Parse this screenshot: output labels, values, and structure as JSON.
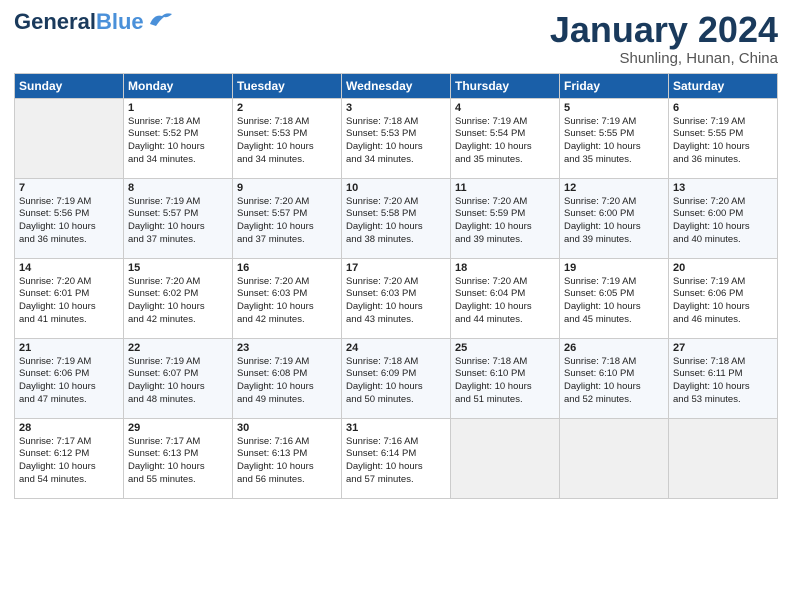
{
  "header": {
    "logo_line1": "General",
    "logo_line2": "Blue",
    "month": "January 2024",
    "location": "Shunling, Hunan, China"
  },
  "days_of_week": [
    "Sunday",
    "Monday",
    "Tuesday",
    "Wednesday",
    "Thursday",
    "Friday",
    "Saturday"
  ],
  "weeks": [
    [
      {
        "day": "",
        "info": ""
      },
      {
        "day": "1",
        "info": "Sunrise: 7:18 AM\nSunset: 5:52 PM\nDaylight: 10 hours\nand 34 minutes."
      },
      {
        "day": "2",
        "info": "Sunrise: 7:18 AM\nSunset: 5:53 PM\nDaylight: 10 hours\nand 34 minutes."
      },
      {
        "day": "3",
        "info": "Sunrise: 7:18 AM\nSunset: 5:53 PM\nDaylight: 10 hours\nand 34 minutes."
      },
      {
        "day": "4",
        "info": "Sunrise: 7:19 AM\nSunset: 5:54 PM\nDaylight: 10 hours\nand 35 minutes."
      },
      {
        "day": "5",
        "info": "Sunrise: 7:19 AM\nSunset: 5:55 PM\nDaylight: 10 hours\nand 35 minutes."
      },
      {
        "day": "6",
        "info": "Sunrise: 7:19 AM\nSunset: 5:55 PM\nDaylight: 10 hours\nand 36 minutes."
      }
    ],
    [
      {
        "day": "7",
        "info": "Sunrise: 7:19 AM\nSunset: 5:56 PM\nDaylight: 10 hours\nand 36 minutes."
      },
      {
        "day": "8",
        "info": "Sunrise: 7:19 AM\nSunset: 5:57 PM\nDaylight: 10 hours\nand 37 minutes."
      },
      {
        "day": "9",
        "info": "Sunrise: 7:20 AM\nSunset: 5:57 PM\nDaylight: 10 hours\nand 37 minutes."
      },
      {
        "day": "10",
        "info": "Sunrise: 7:20 AM\nSunset: 5:58 PM\nDaylight: 10 hours\nand 38 minutes."
      },
      {
        "day": "11",
        "info": "Sunrise: 7:20 AM\nSunset: 5:59 PM\nDaylight: 10 hours\nand 39 minutes."
      },
      {
        "day": "12",
        "info": "Sunrise: 7:20 AM\nSunset: 6:00 PM\nDaylight: 10 hours\nand 39 minutes."
      },
      {
        "day": "13",
        "info": "Sunrise: 7:20 AM\nSunset: 6:00 PM\nDaylight: 10 hours\nand 40 minutes."
      }
    ],
    [
      {
        "day": "14",
        "info": "Sunrise: 7:20 AM\nSunset: 6:01 PM\nDaylight: 10 hours\nand 41 minutes."
      },
      {
        "day": "15",
        "info": "Sunrise: 7:20 AM\nSunset: 6:02 PM\nDaylight: 10 hours\nand 42 minutes."
      },
      {
        "day": "16",
        "info": "Sunrise: 7:20 AM\nSunset: 6:03 PM\nDaylight: 10 hours\nand 42 minutes."
      },
      {
        "day": "17",
        "info": "Sunrise: 7:20 AM\nSunset: 6:03 PM\nDaylight: 10 hours\nand 43 minutes."
      },
      {
        "day": "18",
        "info": "Sunrise: 7:20 AM\nSunset: 6:04 PM\nDaylight: 10 hours\nand 44 minutes."
      },
      {
        "day": "19",
        "info": "Sunrise: 7:19 AM\nSunset: 6:05 PM\nDaylight: 10 hours\nand 45 minutes."
      },
      {
        "day": "20",
        "info": "Sunrise: 7:19 AM\nSunset: 6:06 PM\nDaylight: 10 hours\nand 46 minutes."
      }
    ],
    [
      {
        "day": "21",
        "info": "Sunrise: 7:19 AM\nSunset: 6:06 PM\nDaylight: 10 hours\nand 47 minutes."
      },
      {
        "day": "22",
        "info": "Sunrise: 7:19 AM\nSunset: 6:07 PM\nDaylight: 10 hours\nand 48 minutes."
      },
      {
        "day": "23",
        "info": "Sunrise: 7:19 AM\nSunset: 6:08 PM\nDaylight: 10 hours\nand 49 minutes."
      },
      {
        "day": "24",
        "info": "Sunrise: 7:18 AM\nSunset: 6:09 PM\nDaylight: 10 hours\nand 50 minutes."
      },
      {
        "day": "25",
        "info": "Sunrise: 7:18 AM\nSunset: 6:10 PM\nDaylight: 10 hours\nand 51 minutes."
      },
      {
        "day": "26",
        "info": "Sunrise: 7:18 AM\nSunset: 6:10 PM\nDaylight: 10 hours\nand 52 minutes."
      },
      {
        "day": "27",
        "info": "Sunrise: 7:18 AM\nSunset: 6:11 PM\nDaylight: 10 hours\nand 53 minutes."
      }
    ],
    [
      {
        "day": "28",
        "info": "Sunrise: 7:17 AM\nSunset: 6:12 PM\nDaylight: 10 hours\nand 54 minutes."
      },
      {
        "day": "29",
        "info": "Sunrise: 7:17 AM\nSunset: 6:13 PM\nDaylight: 10 hours\nand 55 minutes."
      },
      {
        "day": "30",
        "info": "Sunrise: 7:16 AM\nSunset: 6:13 PM\nDaylight: 10 hours\nand 56 minutes."
      },
      {
        "day": "31",
        "info": "Sunrise: 7:16 AM\nSunset: 6:14 PM\nDaylight: 10 hours\nand 57 minutes."
      },
      {
        "day": "",
        "info": ""
      },
      {
        "day": "",
        "info": ""
      },
      {
        "day": "",
        "info": ""
      }
    ]
  ]
}
